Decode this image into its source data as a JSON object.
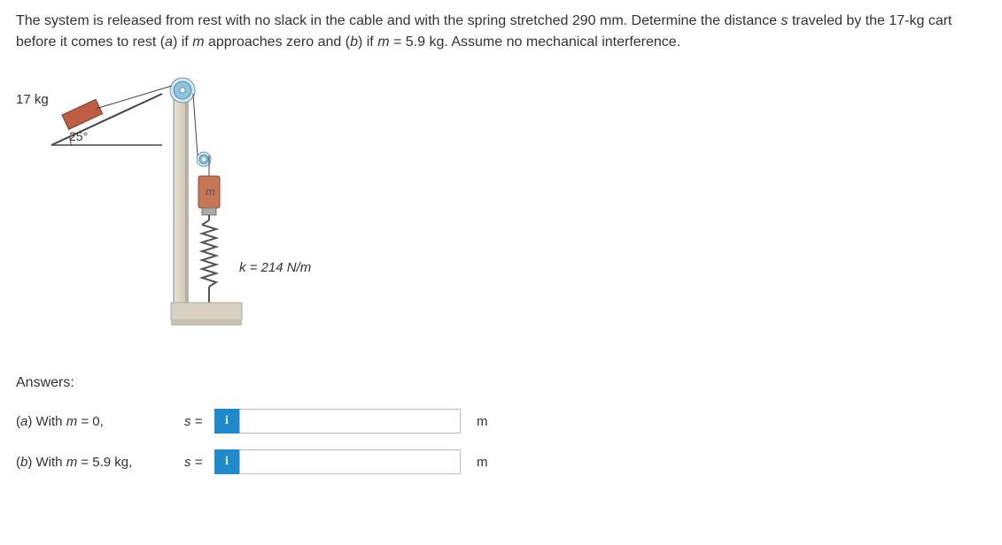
{
  "problem": {
    "text_parts": [
      "The system is released from rest with no slack in the cable and with the spring stretched 290 mm. Determine the distance ",
      "s",
      " traveled by the 17-kg cart before it comes to rest (",
      "a",
      ") if ",
      "m",
      " approaches zero and (",
      "b",
      ") if ",
      "m",
      " = 5.9 kg. Assume no mechanical interference."
    ]
  },
  "figure": {
    "cart_mass": "17 kg",
    "incline_angle": "25°",
    "hanging_mass_symbol": "m",
    "spring_constant": "k = 214 N/m"
  },
  "answers_section": {
    "heading": "Answers:",
    "rows": [
      {
        "label_prefix": "(",
        "label_letter": "a",
        "label_mid": ") With ",
        "label_var": "m",
        "label_suffix": " = 0,",
        "var": "s",
        "eq": " =",
        "value": "",
        "unit": "m"
      },
      {
        "label_prefix": "(",
        "label_letter": "b",
        "label_mid": ") With ",
        "label_var": "m",
        "label_suffix": " = 5.9 kg,",
        "var": "s",
        "eq": " =",
        "value": "",
        "unit": "m"
      }
    ],
    "info_icon": "i"
  }
}
